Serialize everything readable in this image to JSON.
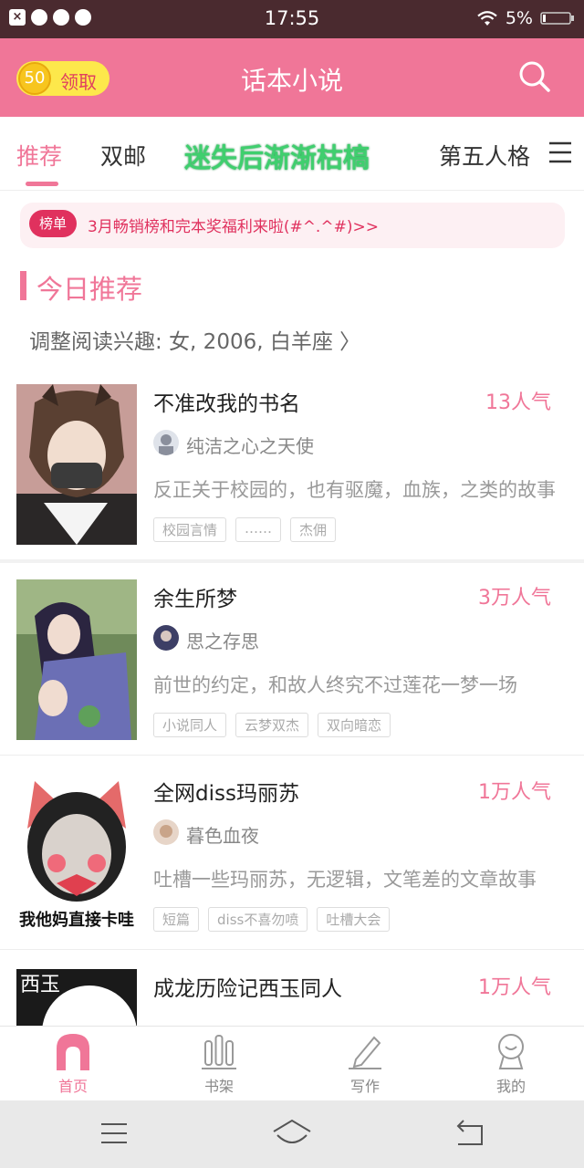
{
  "status_bar": {
    "time": "17:55",
    "battery": "5%"
  },
  "header": {
    "coin_count": "50",
    "coin_label": "领取",
    "title": "话本小说"
  },
  "tabs": [
    {
      "label": "推荐"
    },
    {
      "label": "双邮"
    },
    {
      "label": "迷失后渐渐枯槁"
    },
    {
      "label": "第五人格"
    }
  ],
  "banner": {
    "badge": "榜单",
    "text": "3月畅销榜和完本奖福利来啦(#^.^#)>>"
  },
  "today": {
    "title": "今日推荐",
    "interest": "调整阅读兴趣: 女, 2006, 白羊座 〉"
  },
  "books": [
    {
      "title": "不准改我的书名",
      "popularity": "13人气",
      "author": "纯洁之心之天使",
      "desc": "反正关于校园的，也有驱魔，血族，之类的故事",
      "tags": [
        "校园言情",
        "……",
        "杰佣"
      ]
    },
    {
      "title": "余生所梦",
      "popularity": "3万人气",
      "author": "思之存思",
      "desc": "前世的约定，和故人终究不过莲花一梦一场",
      "tags": [
        "小说同人",
        "云梦双杰",
        "双向暗恋"
      ]
    },
    {
      "title": "全网diss玛丽苏",
      "popularity": "1万人气",
      "author": "暮色血夜",
      "desc": "吐槽一些玛丽苏，无逻辑，文笔差的文章故事",
      "tags": [
        "短篇",
        "diss不喜勿喷",
        "吐槽大会"
      ],
      "cover_caption": "我他妈直接卡哇"
    },
    {
      "title": "成龙历险记西玉同人",
      "popularity": "1万人气",
      "cover_caption": "西玉"
    }
  ],
  "bottom_nav": [
    {
      "label": "首页"
    },
    {
      "label": "书架"
    },
    {
      "label": "写作"
    },
    {
      "label": "我的"
    }
  ],
  "colors": {
    "accent": "#f07698",
    "banner_red": "#e0315e",
    "status_bar": "#4a2a2f"
  }
}
